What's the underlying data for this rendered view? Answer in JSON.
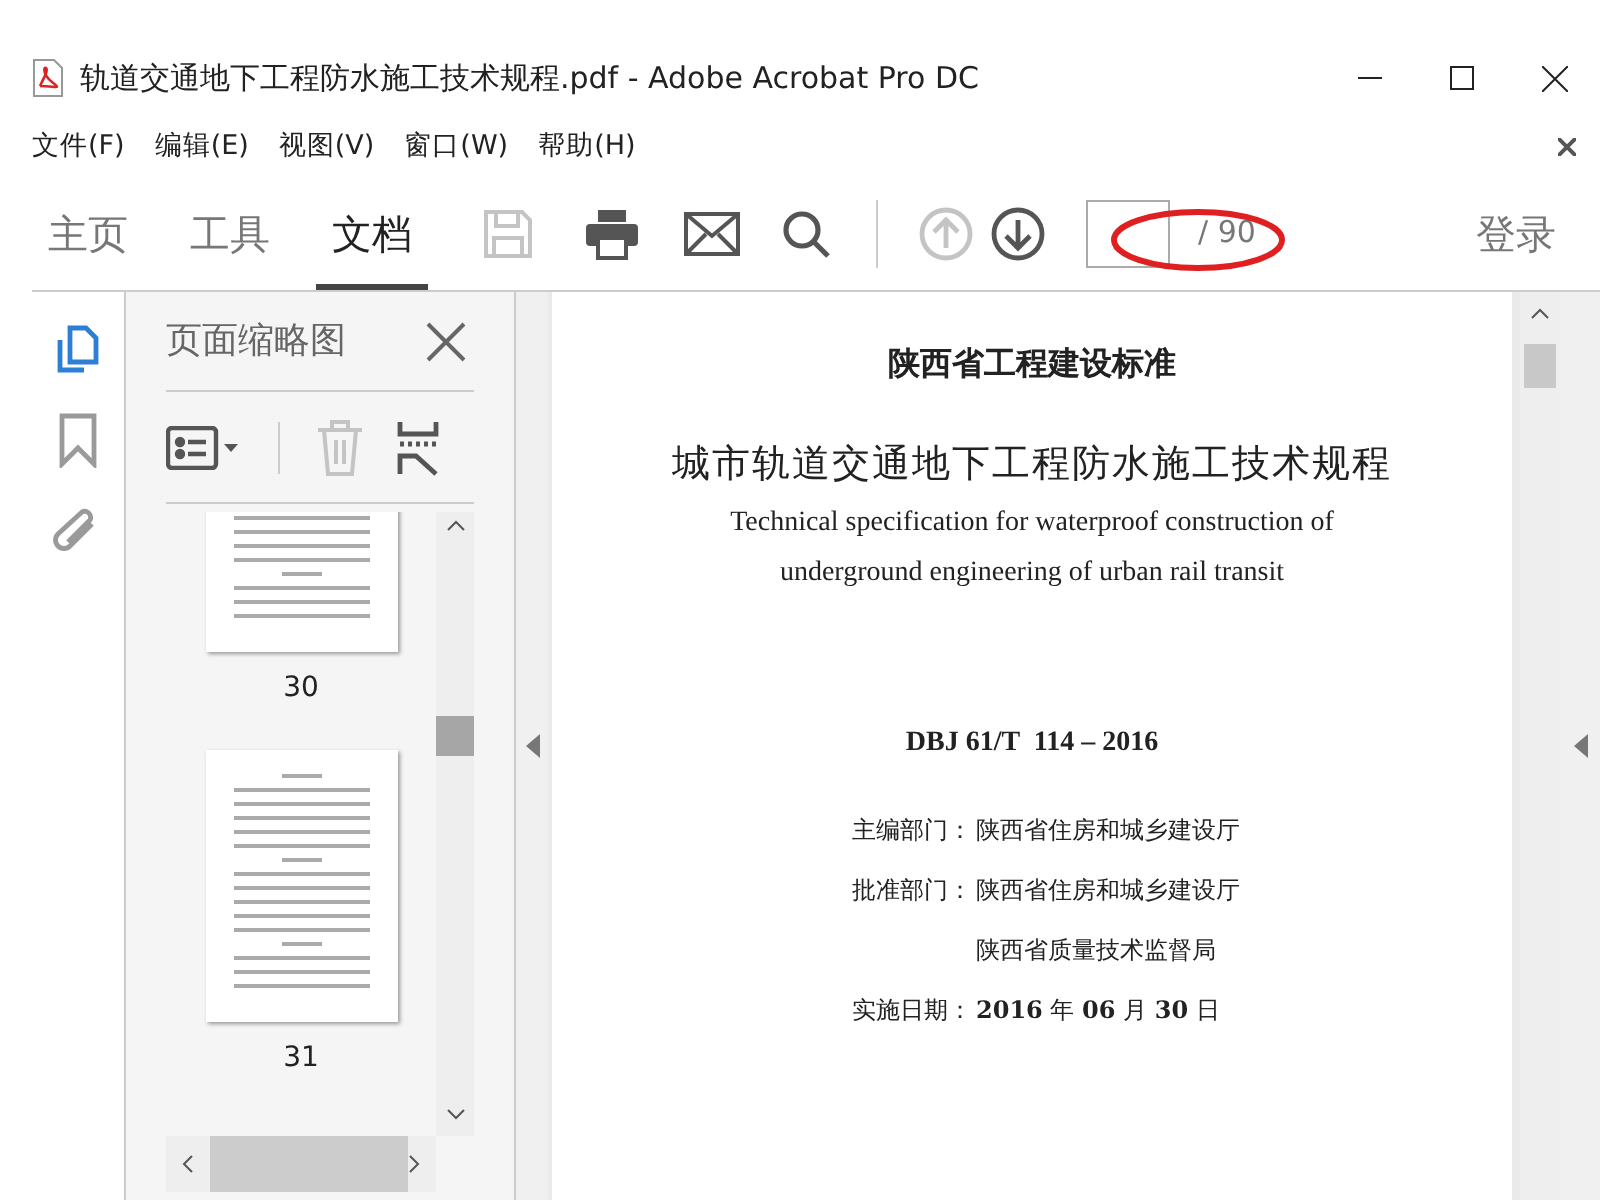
{
  "window": {
    "title": "轨道交通地下工程防水施工技术规程.pdf - Adobe Acrobat Pro DC"
  },
  "menu": [
    "文件(F)",
    "编辑(E)",
    "视图(V)",
    "窗口(W)",
    "帮助(H)"
  ],
  "tabs": [
    {
      "label": "主页",
      "selected": false
    },
    {
      "label": "工具",
      "selected": false
    },
    {
      "label": "文档",
      "selected": true
    }
  ],
  "toolbar": {
    "save_disabled": true,
    "prev_disabled": true,
    "next_disabled": false,
    "page_total": "/ 90",
    "sign_in": "登录"
  },
  "side_rail": [
    {
      "kind": "pages",
      "selected": true
    },
    {
      "kind": "bookmark",
      "selected": false
    },
    {
      "kind": "attachment",
      "selected": false
    }
  ],
  "thumbnails_panel": {
    "title": "页面缩略图",
    "delete_disabled": true,
    "pages": [
      {
        "label": "30"
      },
      {
        "label": "31"
      }
    ]
  },
  "document": {
    "lines": [
      {
        "kind": "heading",
        "text": "陕西省工程建设标准"
      },
      {
        "kind": "title",
        "text": "城市轨道交通地下工程防水施工技术规程"
      },
      {
        "kind": "english",
        "text": "Technical specification for waterproof construction of"
      },
      {
        "kind": "english",
        "text": "underground engineering of urban rail transit"
      },
      {
        "kind": "code",
        "text": "DBJ 61/T  114 – 2016"
      },
      {
        "kind": "info",
        "label": "主编部门：",
        "text": "陕西省住房和城乡建设厅"
      },
      {
        "kind": "info",
        "label": "批准部门：",
        "text": "陕西省住房和城乡建设厅"
      },
      {
        "kind": "info",
        "text": "陕西省质量技术监督局"
      },
      {
        "kind": "info",
        "label": "实施日期：",
        "text": "**2016** 年 **06** 月 **30** 日"
      }
    ]
  }
}
